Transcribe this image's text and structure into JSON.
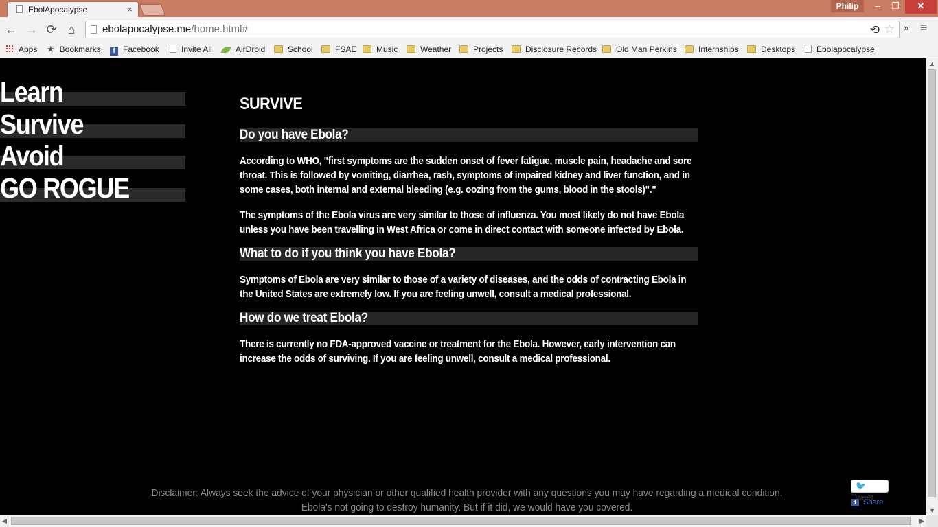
{
  "browser": {
    "tab_title": "EbolApocalypse",
    "tab_close": "×",
    "user_name": "Philip",
    "window_buttons": {
      "minimize": "–",
      "maximize": "❐",
      "close": "✕"
    },
    "url_host": "ebolapocalypse.me",
    "url_path": "/home.html#",
    "nav": {
      "back": "←",
      "forward": "→",
      "reload": "⟳",
      "home": "⌂"
    },
    "icons": {
      "extension": "⟲",
      "star": "☆",
      "overflow": "»",
      "menu": "≡"
    },
    "bookmarks": [
      {
        "label": "Apps",
        "icon": "apps-icon"
      },
      {
        "label": "Bookmarks",
        "icon": "star-icon"
      },
      {
        "label": "Facebook",
        "icon": "facebook-icon"
      },
      {
        "label": "Invite All",
        "icon": "page-icon"
      },
      {
        "label": "AirDroid",
        "icon": "airdroid-icon"
      },
      {
        "label": "School",
        "icon": "folder-icon"
      },
      {
        "label": "FSAE",
        "icon": "folder-icon"
      },
      {
        "label": "Music",
        "icon": "folder-icon"
      },
      {
        "label": "Weather",
        "icon": "folder-icon"
      },
      {
        "label": "Projects",
        "icon": "folder-icon"
      },
      {
        "label": "Disclosure Records",
        "icon": "folder-icon"
      },
      {
        "label": "Old Man Perkins",
        "icon": "folder-icon"
      },
      {
        "label": "Internships",
        "icon": "folder-icon"
      },
      {
        "label": "Desktops",
        "icon": "folder-icon"
      },
      {
        "label": "Ebolapocalypse",
        "icon": "page-icon"
      }
    ]
  },
  "sidebar": {
    "items": [
      {
        "label": "Learn"
      },
      {
        "label": "Survive"
      },
      {
        "label": "Avoid"
      },
      {
        "label": "GO ROGUE"
      }
    ]
  },
  "main": {
    "title": "SURVIVE",
    "sections": [
      {
        "heading": "Do you have Ebola?",
        "paragraphs": [
          "According to WHO, \"first symptoms are the sudden onset of fever fatigue, muscle pain, headache and sore throat. This is followed by vomiting, diarrhea, rash, symptoms of impaired kidney and liver function, and in some cases, both internal and external bleeding (e.g. oozing from the gums, blood in the stools)\".\"",
          "The symptoms of the Ebola virus are very similar to those of influenza. You most likely do not have Ebola unless you have been travelling in West Africa or come in direct contact with someone infected by Ebola."
        ]
      },
      {
        "heading": "What to do if you think you have Ebola?",
        "paragraphs": [
          "Symptoms of Ebola are very similar to those of a variety of diseases, and the odds of contracting Ebola in the United States are extremely low. If you are feeling unwell, consult a medical professional."
        ]
      },
      {
        "heading": "How do we treat Ebola?",
        "paragraphs": [
          "There is currently no FDA-approved vaccine or treatment for the Ebola. However, early intervention can increase the odds of surviving. If you are feeling unwell, consult a medical professional."
        ]
      }
    ]
  },
  "footer": {
    "disclaimer_line1": "Disclaimer: Always seek the advice of your physician or other qualified health provider with any questions you may have regarding a medical condition.",
    "disclaimer_line2": "Ebola's not going to destroy humanity. But if it did, we would have you covered."
  },
  "social": {
    "tweet_label": "Tweet",
    "share_label": "Share"
  },
  "colors": {
    "titlebar": "#c87c62",
    "page_background": "#000000",
    "heading_band": "#262626",
    "disclaimer_text": "#8a8a8a"
  }
}
